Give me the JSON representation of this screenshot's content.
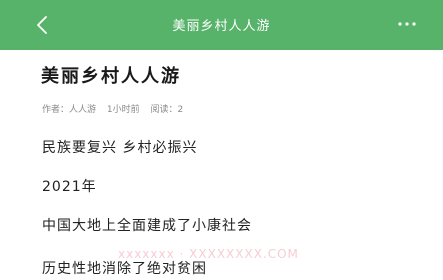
{
  "header": {
    "back_icon": "chevron-left-icon",
    "title": "美丽乡村人人游",
    "more_label": "···",
    "color": "#58b36a"
  },
  "article": {
    "title": "美丽乡村人人游",
    "meta": {
      "author": "作者：人人游",
      "time": "1小时前",
      "reads": "阅读：2"
    },
    "paragraphs": [
      "民族要复兴 乡村必振兴",
      "2021年",
      "中国大地上全面建成了小康社会",
      "历史性地消除了绝对贫困"
    ]
  },
  "watermark": "xxxxxxx · XXXXXXXX.COM"
}
